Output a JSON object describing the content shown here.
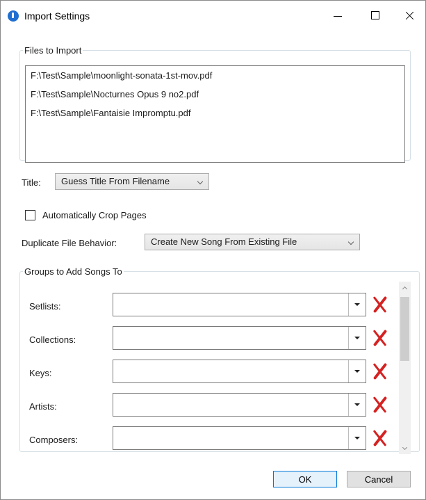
{
  "window": {
    "title": "Import Settings"
  },
  "files": {
    "legend": "Files to Import",
    "items": [
      "F:\\Test\\Sample\\moonlight-sonata-1st-mov.pdf",
      "F:\\Test\\Sample\\Nocturnes Opus 9 no2.pdf",
      "F:\\Test\\Sample\\Fantaisie Impromptu.pdf"
    ]
  },
  "title_option": {
    "label": "Title:",
    "selected": "Guess Title From Filename"
  },
  "crop": {
    "label": "Automatically Crop Pages",
    "checked": false
  },
  "duplicate": {
    "label": "Duplicate File Behavior:",
    "selected": "Create New Song From Existing File"
  },
  "groups": {
    "legend": "Groups to Add Songs To",
    "rows": [
      {
        "label": "Setlists:",
        "value": ""
      },
      {
        "label": "Collections:",
        "value": ""
      },
      {
        "label": "Keys:",
        "value": ""
      },
      {
        "label": "Artists:",
        "value": ""
      },
      {
        "label": "Composers:",
        "value": ""
      }
    ]
  },
  "buttons": {
    "ok": "OK",
    "cancel": "Cancel"
  },
  "colors": {
    "accent": "#0078d7",
    "remove_icon": "#d42222"
  }
}
